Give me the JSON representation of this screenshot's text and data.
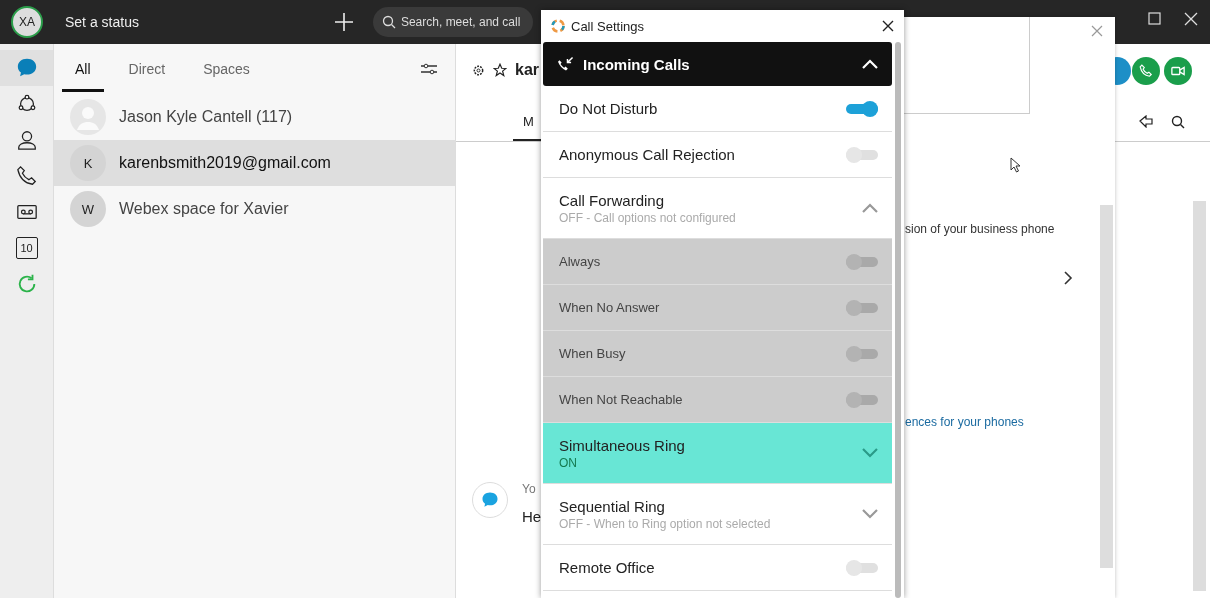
{
  "top_bar": {
    "avatar": "XA",
    "status": "Set a status",
    "search": {
      "placeholder": "Search, meet, and call"
    }
  },
  "rail": [
    {
      "kind": "chat",
      "selected": true
    },
    {
      "kind": "teams",
      "selected": false
    },
    {
      "kind": "contacts",
      "selected": false
    },
    {
      "kind": "calls",
      "selected": false
    },
    {
      "kind": "voicemail",
      "selected": false
    },
    {
      "kind": "calendar",
      "selected": false,
      "label": "10"
    },
    {
      "kind": "refresh",
      "selected": false
    }
  ],
  "tabs": [
    {
      "label": "All",
      "selected": true
    },
    {
      "label": "Direct",
      "selected": false
    },
    {
      "label": "Spaces",
      "selected": false
    }
  ],
  "conversations": [
    {
      "name": "Jason Kyle Cantell (117)",
      "avatar": {
        "kind": "photo"
      },
      "selected": false
    },
    {
      "name": "karenbsmith2019@gmail.com",
      "avatar": {
        "kind": "initial",
        "text": "K"
      },
      "selected": true
    },
    {
      "name": "Webex space for Xavier",
      "avatar": {
        "kind": "initial",
        "text": "W"
      },
      "selected": false
    }
  ],
  "space": {
    "title": "kar",
    "tab": "M",
    "message": {
      "sender": "Yo",
      "text": "He"
    }
  },
  "background_dialog": {
    "texts": [
      {
        "kind": "text",
        "text": "sion of your business phone"
      },
      {
        "kind": "link",
        "text": "ences for your phones"
      }
    ]
  },
  "call_settings": {
    "title": "Call Settings",
    "section": {
      "title": "Incoming Calls",
      "expanded": true
    },
    "items": [
      {
        "kind": "toggle",
        "label": "Do Not Disturb",
        "on": true
      },
      {
        "kind": "toggle",
        "label": "Anonymous Call Rejection",
        "on": false
      },
      {
        "kind": "expandable",
        "label": "Call Forwarding",
        "subtitle": "OFF - Call options not configured",
        "expanded": true,
        "selected": false,
        "children": [
          {
            "kind": "toggle",
            "label": "Always",
            "on": false,
            "disabled": true
          },
          {
            "kind": "toggle",
            "label": "When No Answer",
            "on": false,
            "disabled": true
          },
          {
            "kind": "toggle",
            "label": "When Busy",
            "on": false,
            "disabled": true
          },
          {
            "kind": "toggle",
            "label": "When Not Reachable",
            "on": false,
            "disabled": true
          }
        ]
      },
      {
        "kind": "expandable",
        "label": "Simultaneous Ring",
        "subtitle": "ON",
        "expanded": false,
        "selected": true
      },
      {
        "kind": "expandable",
        "label": "Sequential Ring",
        "subtitle": "OFF - When to Ring option not selected",
        "expanded": false,
        "selected": false
      },
      {
        "kind": "toggle",
        "label": "Remote Office",
        "on": false
      }
    ]
  }
}
